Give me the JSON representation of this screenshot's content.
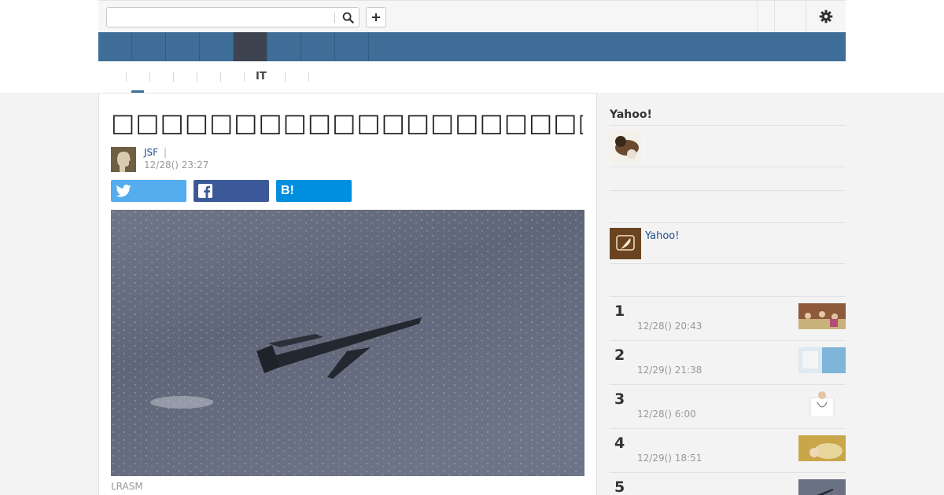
{
  "header": {
    "search_placeholder": "",
    "search_icon": "search-icon",
    "add_icon": "plus-icon",
    "settings_icon": "gear-icon"
  },
  "nav": {
    "items": [
      "",
      "",
      "",
      "",
      "",
      "",
      "",
      "",
      ""
    ],
    "active_index": 4
  },
  "subnav": {
    "items": [
      "",
      "",
      "",
      "",
      "",
      "IT",
      ""
    ],
    "active_index": 0
  },
  "article": {
    "title": "□□□□□□□□□□□□□□□□□□□□□□□□□□□□□□□",
    "author": "JSF",
    "author_separator": "|",
    "published": "12/28() 23:27",
    "share": {
      "twitter_icon": "twitter-icon",
      "facebook_icon": "facebook-icon",
      "hatena_label": "B!"
    },
    "caption": "LRASM"
  },
  "sidebar": {
    "title": "Yahoo!",
    "link_text": "Yahoo!",
    "ranking": [
      {
        "rank": "1",
        "time": "12/28() 20:43"
      },
      {
        "rank": "2",
        "time": "12/29() 21:38"
      },
      {
        "rank": "3",
        "time": "12/28() 6:00"
      },
      {
        "rank": "4",
        "time": "12/29() 18:51"
      },
      {
        "rank": "5",
        "time": ""
      }
    ]
  },
  "colors": {
    "nav_blue": "#3f6e98",
    "nav_active": "#3d4450",
    "twitter": "#55acee",
    "facebook": "#3b5998",
    "hatena": "#008fde",
    "link": "#1a4d8a"
  }
}
